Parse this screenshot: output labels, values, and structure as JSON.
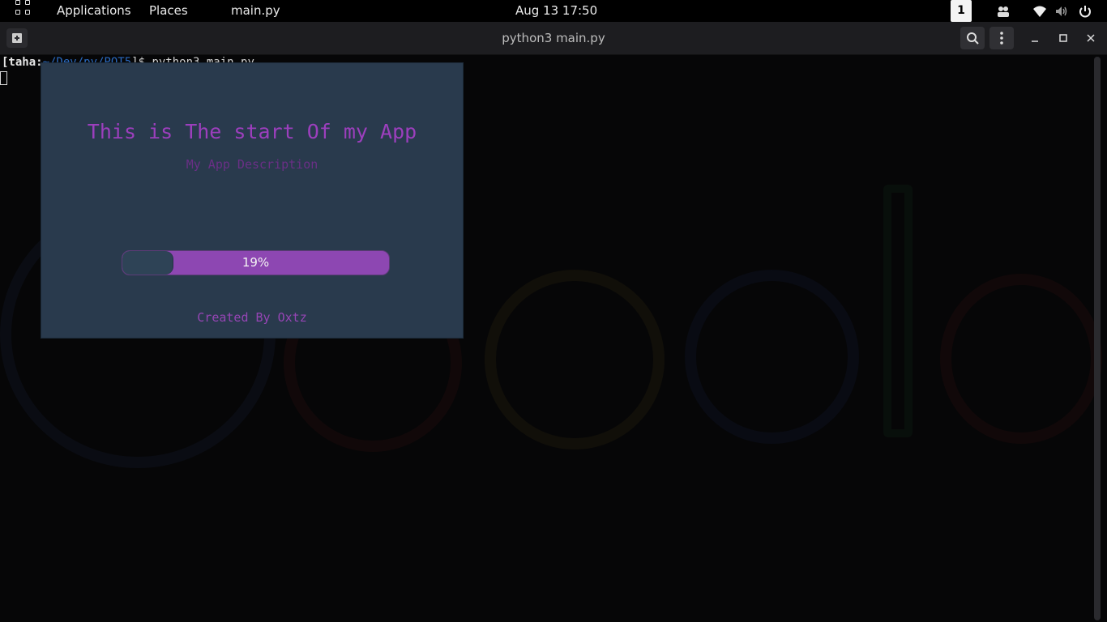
{
  "topbar": {
    "applications_label": "Applications",
    "places_label": "Places",
    "focused_app": "main.py",
    "clock": "Aug 13  17:50",
    "workspace_number": "1",
    "icons": [
      "app-grid-icon",
      "people-icon",
      "wifi-icon",
      "volume-icon",
      "power-icon"
    ]
  },
  "terminal": {
    "title": "python3 main.py",
    "prompt_user": "[taha:",
    "prompt_path": "~/Dev/py/POT5",
    "prompt_suffix": "]$ python3 main.py",
    "header_icons": [
      "new-tab-icon",
      "search-icon",
      "menu-icon",
      "minimize-icon",
      "maximize-icon",
      "close-icon"
    ]
  },
  "splash": {
    "title": "This is The start Of my App",
    "description": "My App Description",
    "progress_label": "19%",
    "progress_value": 0.19,
    "credit": "Created By Oxtz",
    "colors": {
      "background": "#293a4d",
      "accent": "#9c3fbd",
      "progress_fill": "#8d47b2"
    }
  }
}
